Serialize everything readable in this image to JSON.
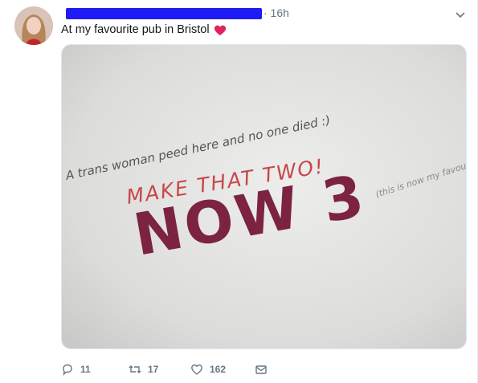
{
  "tweet": {
    "timestamp": "· 16h",
    "text": "At my favourite pub in Bristol",
    "accent_color": "#1f1bf5",
    "heart_emoji_color": "#e0245e"
  },
  "image": {
    "graffiti_line1": "A trans woman peed here and no one died :)",
    "graffiti_line2": "MAKE THAT TWO!",
    "graffiti_line3": "NOW 3",
    "graffiti_note": "(this is now my favourite graffiti)"
  },
  "actions": {
    "reply_count": "11",
    "retweet_count": "17",
    "like_count": "162",
    "icons": [
      "reply-icon",
      "retweet-icon",
      "like-icon",
      "direct-message-icon"
    ]
  }
}
